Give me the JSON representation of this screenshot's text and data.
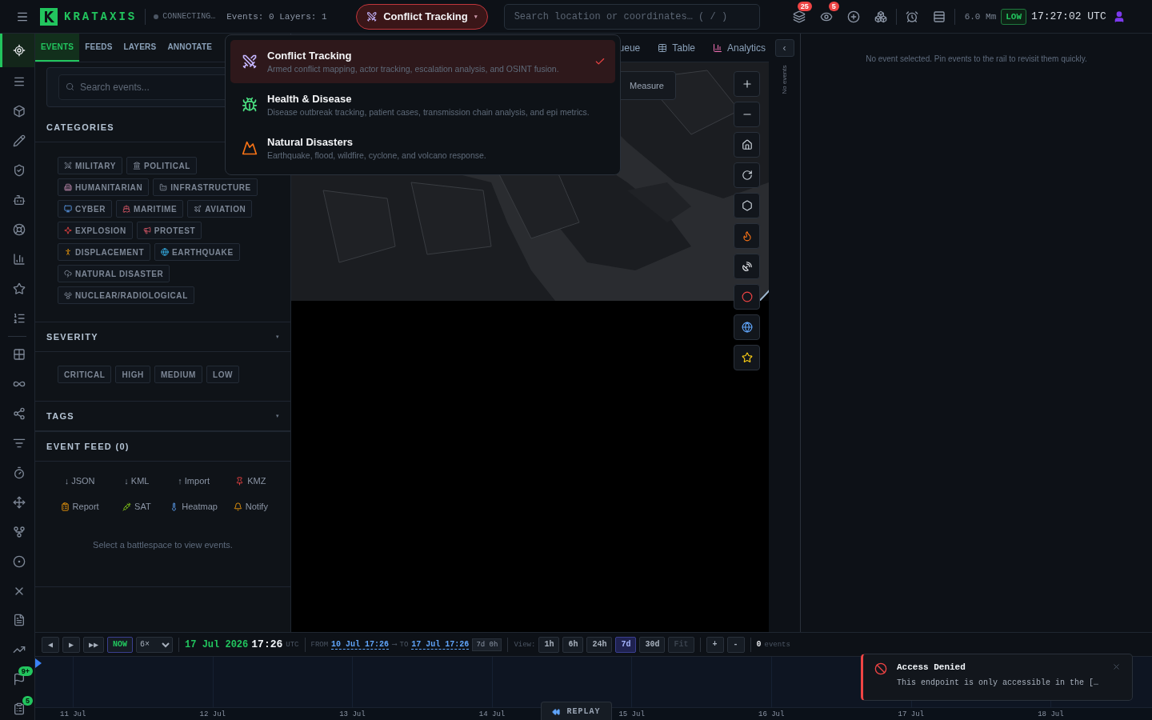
{
  "topbar": {
    "brand": "KRATAXIS",
    "status": "CONNECTING…",
    "stats": "Events: 0 Layers: 1",
    "mode": "Conflict Tracking",
    "search_placeholder": "Search location or coordinates… ( / )",
    "mode_caret": "▾",
    "tool_badges": [
      "25",
      "5"
    ],
    "scale": "6.0 Mm",
    "threat": "LOW",
    "clock": "17:27:02 UTC"
  },
  "rail": {
    "groups": [
      [
        {
          "selected": true
        },
        {
          "selected": false
        },
        {
          "selected": false
        },
        {
          "selected": false
        },
        {
          "selected": false
        },
        {
          "selected": false
        },
        {
          "selected": false
        },
        {
          "selected": false
        },
        {
          "selected": false
        },
        {
          "selected": false
        }
      ],
      [
        {
          "selected": false
        },
        {
          "selected": false
        },
        {
          "selected": false
        },
        {
          "selected": false
        },
        {
          "selected": false
        },
        {
          "selected": false
        },
        {
          "selected": false
        },
        {
          "selected": false
        },
        {
          "selected": false
        },
        {
          "selected": false
        },
        {
          "selected": false
        },
        {
          "selected": false,
          "badge": "9+"
        },
        {
          "selected": false,
          "badge": "5"
        }
      ]
    ]
  },
  "panel": {
    "tabs": [
      {
        "label": "EVENTS",
        "selected": true
      },
      {
        "label": "FEEDS",
        "selected": false
      },
      {
        "label": "LAYERS",
        "selected": false
      },
      {
        "label": "ANNOTATE",
        "selected": false
      }
    ],
    "search_placeholder": "Search events...",
    "categories": {
      "title": "CATEGORIES",
      "chips": [
        "MILITARY",
        "POLITICAL",
        "HUMANITARIAN",
        "INFRASTRUCTURE",
        "CYBER",
        "MARITIME",
        "AVIATION",
        "EXPLOSION",
        "PROTEST",
        "DISPLACEMENT",
        "EARTHQUAKE",
        "NATURAL DISASTER",
        "NUCLEAR/RADIOLOGICAL"
      ]
    },
    "severity": {
      "title": "SEVERITY",
      "caret": "▾",
      "chips": [
        "CRITICAL",
        "HIGH",
        "MEDIUM",
        "LOW"
      ]
    },
    "tags": {
      "title": "TAGS",
      "caret": "▾"
    },
    "feed": {
      "title": "EVENT FEED (0)",
      "actions": [
        {
          "label": "↓ JSON"
        },
        {
          "label": "↓ KML"
        },
        {
          "label": "↑ Import"
        },
        {
          "label": "KMZ"
        },
        {
          "label": "Report"
        },
        {
          "label": "SAT"
        },
        {
          "label": "Heatmap"
        },
        {
          "label": "Notify"
        }
      ],
      "empty": "Select a battlespace to view events."
    }
  },
  "mode_menu": [
    {
      "title": "Conflict Tracking",
      "description": "Armed conflict mapping, actor tracking, escalation analysis, and OSINT fusion.",
      "selected": true
    },
    {
      "title": "Health & Disease",
      "description": "Disease outbreak tracking, patient cases, transmission chain analysis, and epi metrics.",
      "selected": false
    },
    {
      "title": "Natural Disasters",
      "description": "Earthquake, flood, wildfire, cyclone, and volcano response.",
      "selected": false
    }
  ],
  "map": {
    "tabs": [
      {
        "label": "ueue"
      },
      {
        "label": "Table"
      },
      {
        "label": "Analytics"
      }
    ],
    "measure": "Measure"
  },
  "side_strip": {
    "collapse": "‹",
    "label": "No events"
  },
  "detail": {
    "empty": "No event selected. Pin events to the rail to revisit them quickly."
  },
  "timeline": {
    "buttons": [
      "◀",
      "▶",
      "▶▶"
    ],
    "now": "NOW",
    "speed": "6×",
    "date": "17 Jul 2026",
    "time": "17:26",
    "zone": "UTC",
    "from_label": "FROM",
    "from": "10 Jul 17:26",
    "arrow": "⟶",
    "to_label": "TO",
    "to": "17 Jul 17:26",
    "span": "7d 0h",
    "view_label": "View:",
    "ranges": [
      {
        "label": "1h",
        "selected": false,
        "disabled": false
      },
      {
        "label": "6h",
        "selected": false,
        "disabled": false
      },
      {
        "label": "24h",
        "selected": false,
        "disabled": false
      },
      {
        "label": "7d",
        "selected": true,
        "disabled": false
      },
      {
        "label": "30d",
        "selected": false,
        "disabled": false
      },
      {
        "label": "Fit",
        "selected": false,
        "disabled": true
      }
    ],
    "zoom": [
      "+",
      "-"
    ],
    "count": "0",
    "count_label": "events",
    "days": [
      "11 Jul",
      "12 Jul",
      "13 Jul",
      "14 Jul",
      "15 Jul",
      "16 Jul",
      "17 Jul",
      "18 Jul"
    ],
    "replay": "REPLAY"
  },
  "toast": {
    "title": "Access Denied",
    "message": "This endpoint is only accessible in the […"
  }
}
